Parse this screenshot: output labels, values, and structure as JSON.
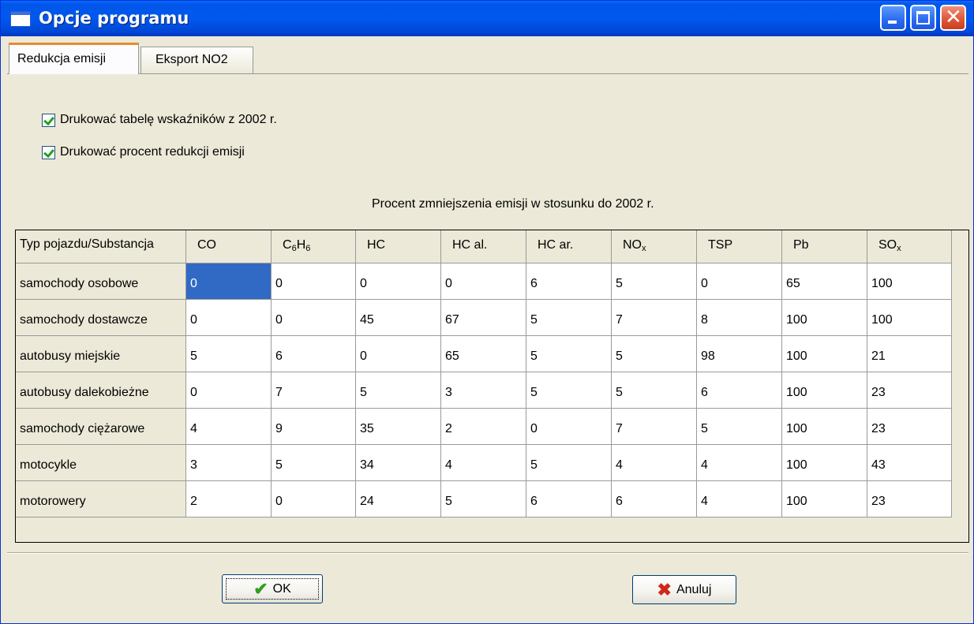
{
  "window": {
    "title": "Opcje programu",
    "icons": {
      "app": "window-icon",
      "minimize": "minimize-icon",
      "maximize": "maximize-icon",
      "close": "close-icon"
    }
  },
  "tabs": [
    {
      "label": "Redukcja emisji",
      "active": true
    },
    {
      "label": "Eksport NO2",
      "active": false
    }
  ],
  "options": {
    "print_table": {
      "label": "Drukować tabelę wskaźników z 2002 r.",
      "checked": true
    },
    "print_percent": {
      "label": "Drukować procent redukcji emisji",
      "checked": true
    }
  },
  "table": {
    "caption": "Procent zmniejszenia emisji w stosunku do 2002 r.",
    "corner": "Typ pojazdu/Substancja",
    "columns": [
      {
        "main": "CO",
        "sub": "",
        "tail": ""
      },
      {
        "main": "C",
        "sub": "6",
        "tail": "H",
        "sub2": "6"
      },
      {
        "main": "HC",
        "sub": "",
        "tail": ""
      },
      {
        "main": "HC al.",
        "sub": "",
        "tail": ""
      },
      {
        "main": "HC ar.",
        "sub": "",
        "tail": ""
      },
      {
        "main": "NO",
        "sub": "x",
        "tail": ""
      },
      {
        "main": "TSP",
        "sub": "",
        "tail": ""
      },
      {
        "main": "Pb",
        "sub": "",
        "tail": ""
      },
      {
        "main": "SO",
        "sub": "x",
        "tail": ""
      }
    ],
    "rows": [
      {
        "label": "samochody osobowe",
        "values": [
          "0",
          "0",
          "0",
          "0",
          "6",
          "5",
          "0",
          "65",
          "100"
        ]
      },
      {
        "label": "samochody dostawcze",
        "values": [
          "0",
          "0",
          "45",
          "67",
          "5",
          "7",
          "8",
          "100",
          "100"
        ]
      },
      {
        "label": "autobusy miejskie",
        "values": [
          "5",
          "6",
          "0",
          "65",
          "5",
          "5",
          "98",
          "100",
          "21"
        ]
      },
      {
        "label": "autobusy dalekobieżne",
        "values": [
          "0",
          "7",
          "5",
          "3",
          "5",
          "5",
          "6",
          "100",
          "23"
        ]
      },
      {
        "label": "samochody ciężarowe",
        "values": [
          "4",
          "9",
          "35",
          "2",
          "0",
          "7",
          "5",
          "100",
          "23"
        ]
      },
      {
        "label": "motocykle",
        "values": [
          "3",
          "5",
          "34",
          "4",
          "5",
          "4",
          "4",
          "100",
          "43"
        ]
      },
      {
        "label": "motorowery",
        "values": [
          "2",
          "0",
          "24",
          "5",
          "6",
          "6",
          "4",
          "100",
          "23"
        ]
      }
    ],
    "selected_cell": {
      "row": 0,
      "col": 0
    },
    "selection_color": "#316ac5"
  },
  "buttons": {
    "ok": {
      "label": "OK",
      "icon": "checkmark-icon"
    },
    "cancel": {
      "label": "Anuluj",
      "icon": "x-icon"
    }
  },
  "colors": {
    "titlebar": "#0058ee",
    "face": "#ece9d8",
    "active_tab_accent": "#e68b2c"
  }
}
